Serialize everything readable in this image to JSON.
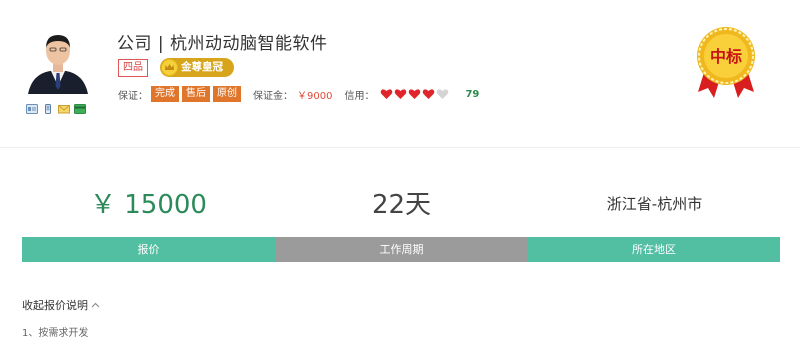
{
  "company": {
    "title": "公司 | 杭州动动脑智能软件"
  },
  "badges": {
    "rank": "四品",
    "crown": "金尊皇冠"
  },
  "guarantee": {
    "label": "保证：",
    "tags": [
      "完成",
      "售后",
      "原创"
    ],
    "deposit_label": "保证金：",
    "deposit_value": "￥9000",
    "credit_label": "信用：",
    "hearts_filled": 4,
    "hearts_total": 5,
    "credit_score": "79"
  },
  "medal": {
    "text": "中标"
  },
  "stats": {
    "price": "￥ 15000",
    "period": "22天",
    "region": "浙江省-杭州市",
    "price_label": "报价",
    "period_label": "工作周期",
    "region_label": "所在地区"
  },
  "notes": {
    "toggle_label": "收起报价说明",
    "items": [
      "1、按需求开发"
    ]
  },
  "colors": {
    "accent_green": "#52bfa3",
    "bar_gray": "#9b9b9b",
    "tag_orange": "#e0762c",
    "crown_gold": "#d6a51c",
    "heart_red": "#e0242c",
    "medal_red": "#d81e1e"
  }
}
